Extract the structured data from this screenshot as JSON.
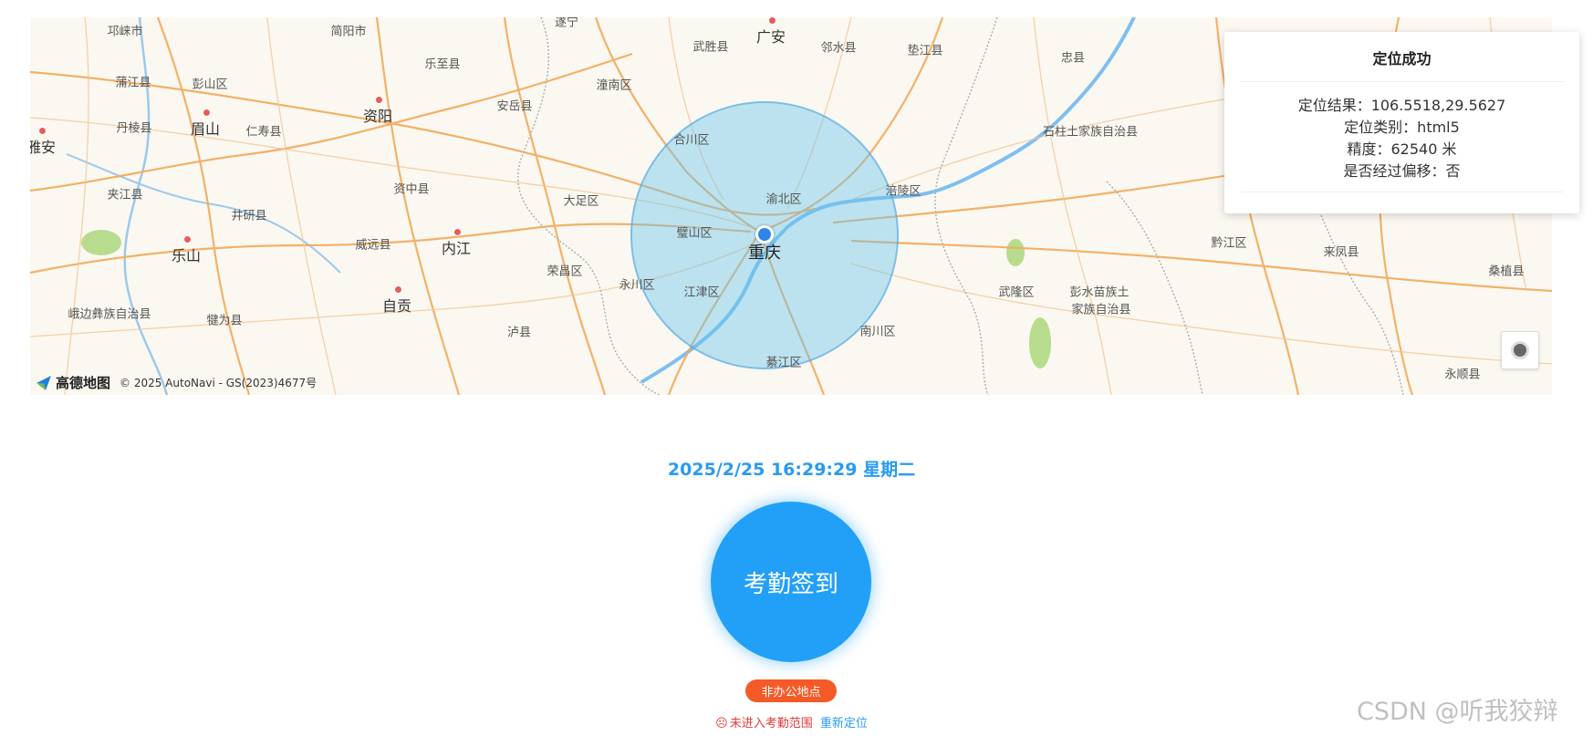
{
  "map": {
    "places": [
      {
        "label": "邛崃市",
        "cls": ""
      },
      {
        "label": "简阳市",
        "cls": ""
      },
      {
        "label": "遂宁",
        "cls": ""
      },
      {
        "label": "武胜县",
        "cls": ""
      },
      {
        "label": "广安",
        "cls": "big dot"
      },
      {
        "label": "邻水县",
        "cls": ""
      },
      {
        "label": "垫江县",
        "cls": ""
      },
      {
        "label": "忠县",
        "cls": ""
      },
      {
        "label": "蒲江县",
        "cls": ""
      },
      {
        "label": "彭山区",
        "cls": ""
      },
      {
        "label": "乐至县",
        "cls": ""
      },
      {
        "label": "安岳县",
        "cls": ""
      },
      {
        "label": "潼南区",
        "cls": ""
      },
      {
        "label": "资阳",
        "cls": "big dot"
      },
      {
        "label": "丹棱县",
        "cls": ""
      },
      {
        "label": "眉山",
        "cls": "big dot"
      },
      {
        "label": "仁寿县",
        "cls": ""
      },
      {
        "label": "合川区",
        "cls": ""
      },
      {
        "label": "石柱土家族自治县",
        "cls": ""
      },
      {
        "label": "雅安",
        "cls": "big dot"
      },
      {
        "label": "资中县",
        "cls": ""
      },
      {
        "label": "大足区",
        "cls": ""
      },
      {
        "label": "渝北区",
        "cls": ""
      },
      {
        "label": "涪陵区",
        "cls": ""
      },
      {
        "label": "夹江县",
        "cls": ""
      },
      {
        "label": "井研县",
        "cls": ""
      },
      {
        "label": "璧山区",
        "cls": ""
      },
      {
        "label": "重庆",
        "cls": "center"
      },
      {
        "label": "威远县",
        "cls": ""
      },
      {
        "label": "内江",
        "cls": "big dot"
      },
      {
        "label": "乐山",
        "cls": "big dot"
      },
      {
        "label": "荣昌区",
        "cls": ""
      },
      {
        "label": "黔江区",
        "cls": ""
      },
      {
        "label": "来凤县",
        "cls": ""
      },
      {
        "label": "桑植县",
        "cls": ""
      },
      {
        "label": "永川区",
        "cls": ""
      },
      {
        "label": "江津区",
        "cls": ""
      },
      {
        "label": "武隆区",
        "cls": ""
      },
      {
        "label": "彭水苗族土",
        "cls": ""
      },
      {
        "label": "家族自治县",
        "cls": ""
      },
      {
        "label": "自贡",
        "cls": "big dot"
      },
      {
        "label": "峨边彝族自治县",
        "cls": ""
      },
      {
        "label": "犍为县",
        "cls": ""
      },
      {
        "label": "泸县",
        "cls": ""
      },
      {
        "label": "南川区",
        "cls": ""
      },
      {
        "label": "綦江区",
        "cls": ""
      },
      {
        "label": "永顺县",
        "cls": ""
      }
    ],
    "logo_text": "高德地图",
    "copyright": "© 2025 AutoNavi - GS(2023)4677号"
  },
  "info": {
    "title": "定位成功",
    "result": "定位结果：106.5518,29.5627",
    "type": "定位类别：html5",
    "accuracy": "精度：62540 米",
    "offset": "是否经过偏移：否"
  },
  "datetime": "2025/2/25 16:29:29 星期二",
  "checkin_label": "考勤签到",
  "status_badge": "非办公地点",
  "range_warning": "未进入考勤范围",
  "relocate_label": "重新定位",
  "watermark": "CSDN @听我狡辩",
  "colors": {
    "accent": "#2a9af0",
    "button": "#22a0f7",
    "badge": "#f45a28",
    "warning": "#e23a3a"
  }
}
